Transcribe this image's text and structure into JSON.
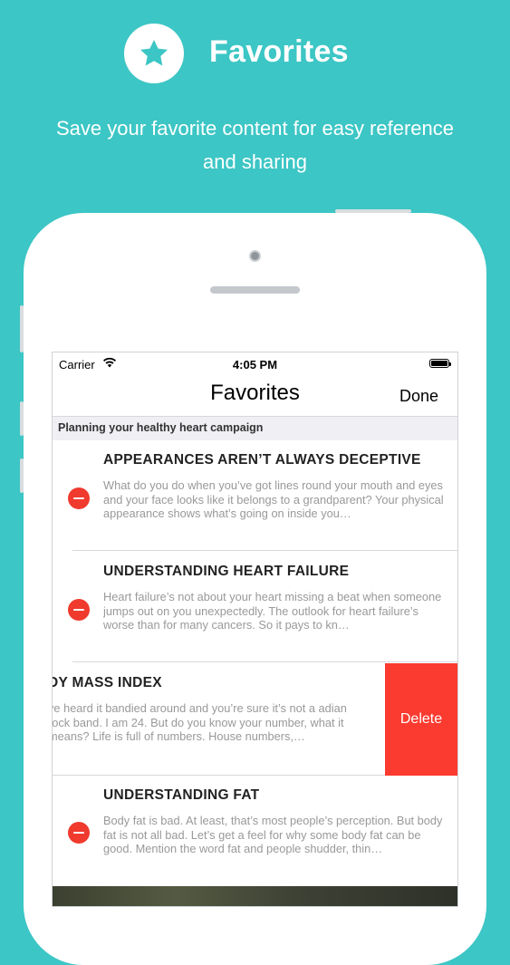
{
  "hero": {
    "icon": "star-icon",
    "title": "Favorites",
    "subtitle_line1": "Save your favorite content for easy reference",
    "subtitle_line2": "and sharing"
  },
  "status_bar": {
    "carrier": "Carrier",
    "time": "4:05 PM"
  },
  "nav": {
    "title": "Favorites",
    "done_label": "Done"
  },
  "section_header": "Planning your healthy heart campaign",
  "items": [
    {
      "title": "APPEARANCES AREN’T ALWAYS DECEPTIVE",
      "body": "What do you do when you’ve got lines round your mouth and eyes and your face looks like it belongs to a grandparent? Your physical appearance shows what’s going on inside you…"
    },
    {
      "title": "UNDERSTANDING HEART FAILURE",
      "body": "Heart failure’s not about your heart missing a beat when someone jumps out on you unexpectedly. The outlook for heart failure’s worse than for many cancers. So it pays to kn…"
    },
    {
      "title": "DY MASS INDEX",
      "body": "ve heard it bandied around and you’re sure it’s not a adian rock band. I am 24. But do you know your number, what it means? Life is full of numbers. House numbers,…"
    },
    {
      "title": "UNDERSTANDING FAT",
      "body": "Body fat is bad. At least, that’s most people’s perception. But body fat is not all bad. Let’s get a feel for why some body fat can be good. Mention the word fat and people shudder, thin…"
    }
  ],
  "swipe_action": {
    "delete_label": "Delete"
  },
  "colors": {
    "background": "#3cc6c5",
    "delete_red": "#fb3b30",
    "delete_circle": "#f03a2e"
  }
}
